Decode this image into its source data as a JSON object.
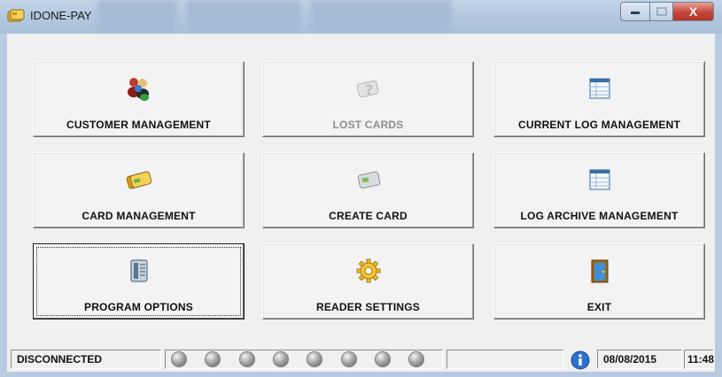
{
  "window": {
    "title": "IDONE-PAY",
    "minimize_icon": "minimize-icon",
    "maximize_icon": "maximize-icon",
    "close_symbol": "X"
  },
  "tiles": [
    {
      "label": "CUSTOMER MANAGEMENT",
      "icon": "users-icon",
      "enabled": true
    },
    {
      "label": "LOST CARDS",
      "icon": "question-card-icon",
      "enabled": false
    },
    {
      "label": "CURRENT LOG MANAGEMENT",
      "icon": "log-table-icon",
      "enabled": true
    },
    {
      "label": "CARD MANAGEMENT",
      "icon": "cards-icon",
      "enabled": true
    },
    {
      "label": "CREATE CARD",
      "icon": "card-icon",
      "enabled": true
    },
    {
      "label": "LOG ARCHIVE MANAGEMENT",
      "icon": "log-table-icon",
      "enabled": true
    },
    {
      "label": "PROGRAM OPTIONS",
      "icon": "options-panel-icon",
      "enabled": true,
      "focused": true
    },
    {
      "label": "READER SETTINGS",
      "icon": "gear-icon",
      "enabled": true
    },
    {
      "label": "EXIT",
      "icon": "door-icon",
      "enabled": true
    }
  ],
  "status": {
    "connection": "DISCONNECTED",
    "indicator_count": 8,
    "info_icon": "info-icon",
    "date": "08/08/2015",
    "time": "11:48"
  }
}
